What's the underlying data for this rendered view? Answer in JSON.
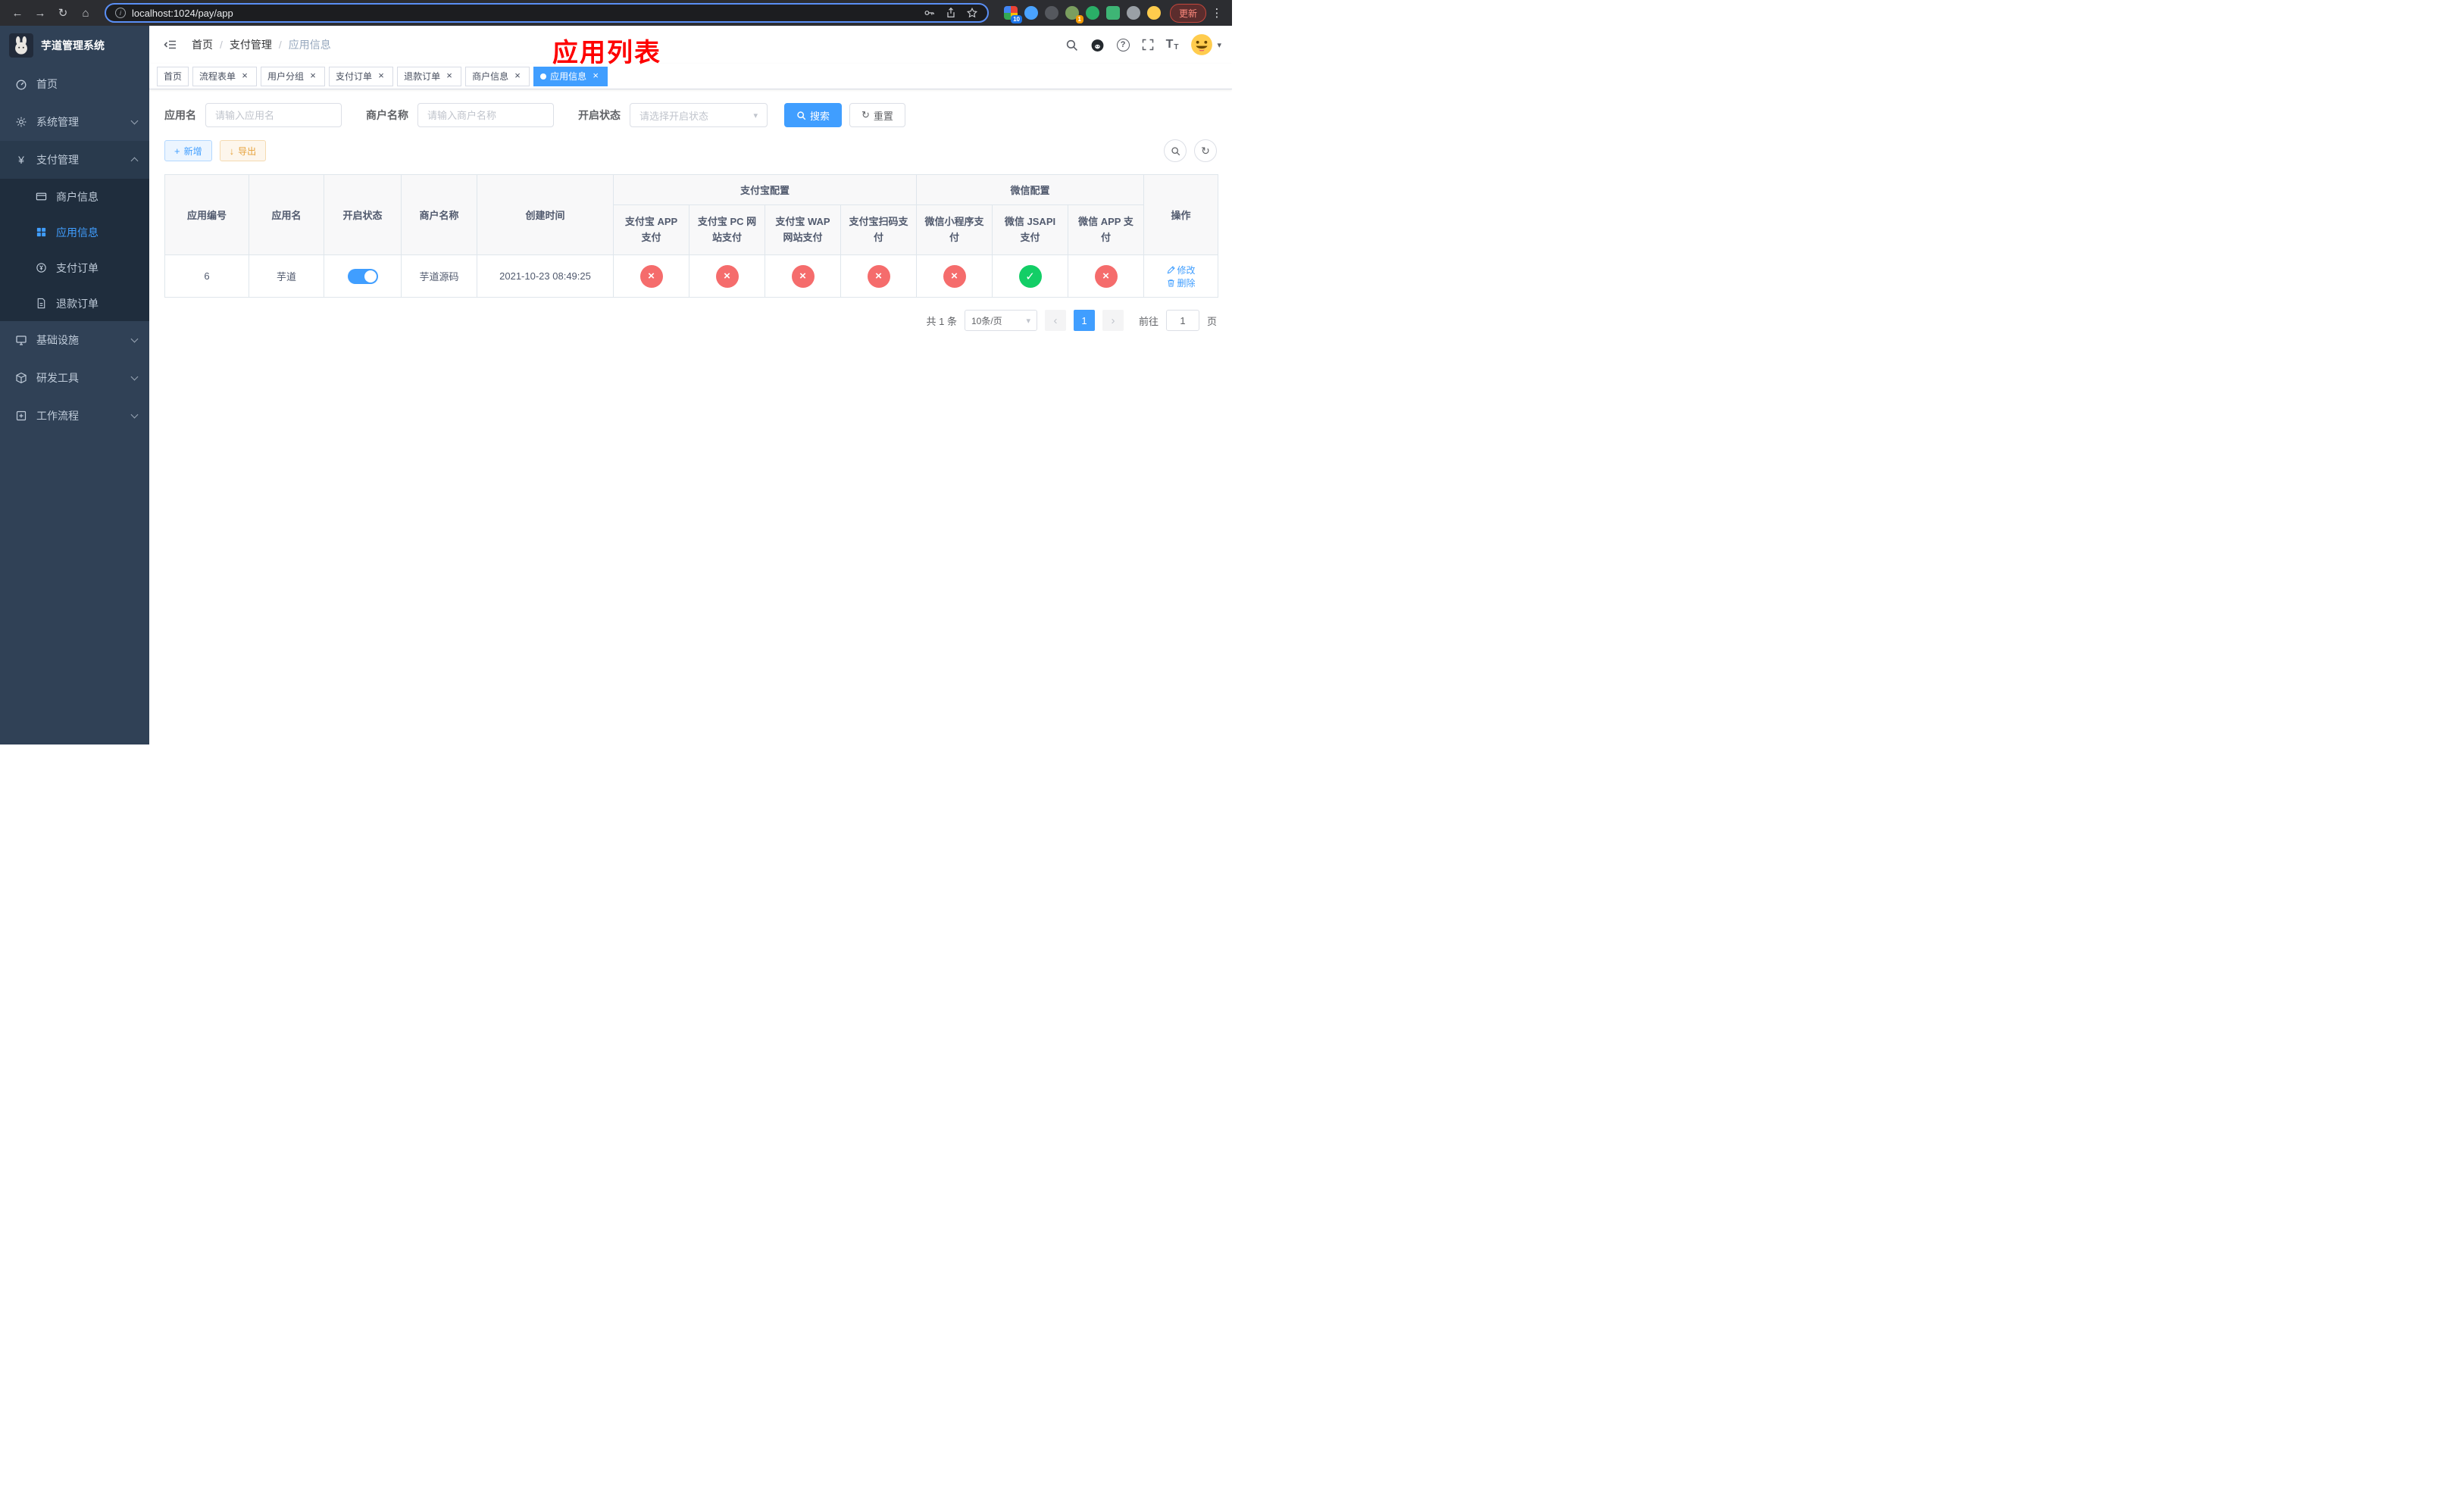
{
  "browser": {
    "url": "localhost:1024/pay/app",
    "update_label": "更新",
    "extensions": {
      "badge_a": "10",
      "badge_b": "1"
    }
  },
  "icons": {
    "back": "←",
    "forward": "→",
    "reload": "↻",
    "home": "⌂",
    "info": "i",
    "more": "⋮",
    "question": "?",
    "caret_down": "▾",
    "chevron_left": "‹",
    "chevron_right": "›",
    "close": "×",
    "check": "✓",
    "plus": "+",
    "download": "↓",
    "refresh": "↻",
    "yen": "¥",
    "font_size_big": "T",
    "font_size_small": "T",
    "slash": "/"
  },
  "sidebar": {
    "title": "芋道管理系统",
    "items": {
      "home": "首页",
      "system": "系统管理",
      "payment": "支付管理",
      "infra": "基础设施",
      "devtools": "研发工具",
      "workflow": "工作流程"
    },
    "payment_children": {
      "merchant": "商户信息",
      "app": "应用信息",
      "order": "支付订单",
      "refund": "退款订单"
    }
  },
  "header": {
    "breadcrumb": [
      "首页",
      "支付管理",
      "应用信息"
    ],
    "annotation": "应用列表"
  },
  "tabs": [
    {
      "label": "首页",
      "closable": false,
      "active": false
    },
    {
      "label": "流程表单",
      "closable": true,
      "active": false
    },
    {
      "label": "用户分组",
      "closable": true,
      "active": false
    },
    {
      "label": "支付订单",
      "closable": true,
      "active": false
    },
    {
      "label": "退款订单",
      "closable": true,
      "active": false
    },
    {
      "label": "商户信息",
      "closable": true,
      "active": false
    },
    {
      "label": "应用信息",
      "closable": true,
      "active": true
    }
  ],
  "filters": {
    "app_name_label": "应用名",
    "app_name_placeholder": "请输入应用名",
    "merchant_label": "商户名称",
    "merchant_placeholder": "请输入商户名称",
    "status_label": "开启状态",
    "status_placeholder": "请选择开启状态",
    "search_label": "搜索",
    "reset_label": "重置"
  },
  "toolbar": {
    "add_label": "新增",
    "export_label": "导出"
  },
  "table": {
    "groups": {
      "alipay": "支付宝配置",
      "wechat": "微信配置"
    },
    "columns": [
      "应用编号",
      "应用名",
      "开启状态",
      "商户名称",
      "创建时间",
      "支付宝 APP 支付",
      "支付宝 PC 网站支付",
      "支付宝 WAP 网站支付",
      "支付宝扫码支付",
      "微信小程序支付",
      "微信 JSAPI 支付",
      "微信 APP 支付",
      "操作"
    ],
    "rows": [
      {
        "id": "6",
        "name": "芋道",
        "enabled": true,
        "merchant": "芋道源码",
        "created": "2021-10-23 08:49:25",
        "alipay_app": false,
        "alipay_pc": false,
        "alipay_wap": false,
        "alipay_qr": false,
        "wechat_mini": false,
        "wechat_jsapi": true,
        "wechat_app": false,
        "edit_label": "修改",
        "delete_label": "删除"
      }
    ]
  },
  "pagination": {
    "total": "共 1 条",
    "page_size": "10条/页",
    "page": "1",
    "goto_label": "前往",
    "goto_value": "1",
    "unit_label": "页"
  },
  "colors": {
    "accent": "#409eff",
    "danger": "#f56c6c",
    "success": "#13ce66",
    "annotation": "#fe0000",
    "sidebar_bg": "#304156",
    "submenu_bg": "#1f2d3d"
  }
}
